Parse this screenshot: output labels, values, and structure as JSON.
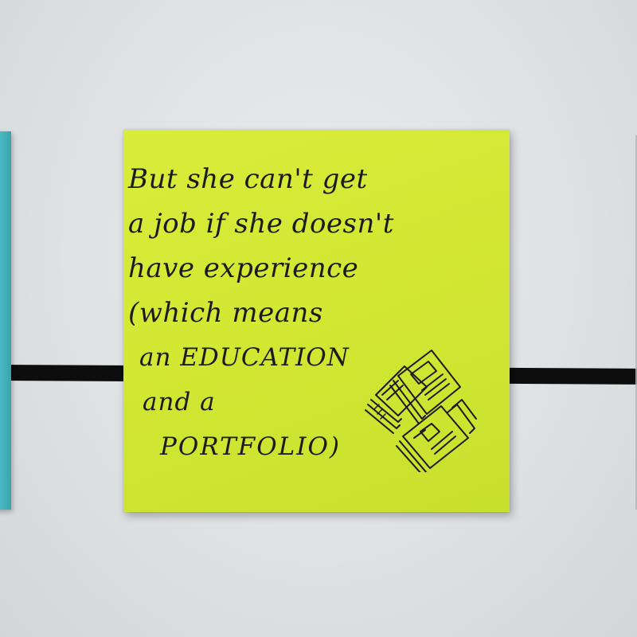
{
  "note": {
    "lines": [
      "But she can't get",
      "a job if she doesn't",
      "have experience",
      "(which means",
      "an EDUCATION",
      "and a",
      "PORTFOLIO)"
    ]
  },
  "colors": {
    "board": "#e2e5e8",
    "sticky_note": "#d4e935",
    "left_note": "#40afbb",
    "line": "#0d0d0d",
    "ink": "#1b1b1b"
  },
  "icons": {
    "doodle": "stacked-papers-icon"
  }
}
